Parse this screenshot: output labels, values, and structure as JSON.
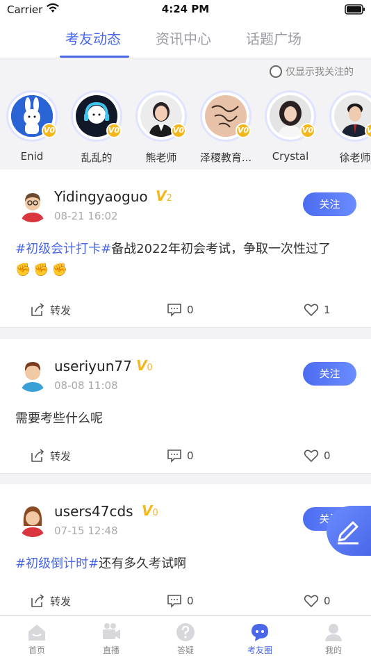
{
  "status_bar": {
    "carrier": "Carrier",
    "time": "4:24 PM"
  },
  "tabs": [
    {
      "label": "考友动态",
      "active": true
    },
    {
      "label": "资讯中心",
      "active": false
    },
    {
      "label": "话题广场",
      "active": false
    }
  ],
  "filter": {
    "label": "仅显示我关注的",
    "checked": false
  },
  "celebrities": [
    {
      "name": "Enid",
      "badge": "V0"
    },
    {
      "name": "乱乱的",
      "badge": "V0"
    },
    {
      "name": "熊老师",
      "badge": "V0"
    },
    {
      "name": "泽稷教育...",
      "badge": "V0"
    },
    {
      "name": "Crystal",
      "badge": "V0"
    },
    {
      "name": "徐老师",
      "badge": "V0"
    }
  ],
  "posts": [
    {
      "user": "Yidingyaoguo",
      "level": "2",
      "time": "08-21 16:02",
      "follow_label": "关注",
      "hashtag": "#初级会计打卡#",
      "text": "备战2022年初会考试，争取一次性过了",
      "emoji": "✊✊✊",
      "forward_label": "转发",
      "comments": "0",
      "likes": "1"
    },
    {
      "user": "useriyun77",
      "level": "0",
      "time": "08-08 11:08",
      "follow_label": "关注",
      "hashtag": "",
      "text": "需要考些什么呢",
      "forward_label": "转发",
      "comments": "0",
      "likes": "0"
    },
    {
      "user": "users47cds",
      "level": "0",
      "time": "07-15 12:48",
      "follow_label": "关注",
      "hashtag": "#初级倒计时#",
      "text": "还有多久考试啊",
      "forward_label": "转发",
      "comments": "0",
      "likes": "0"
    }
  ],
  "bottom_nav": [
    {
      "label": "首页",
      "icon": "home-icon",
      "active": false
    },
    {
      "label": "直播",
      "icon": "video-icon",
      "active": false
    },
    {
      "label": "答疑",
      "icon": "question-icon",
      "active": false
    },
    {
      "label": "考友圈",
      "icon": "chat-icon",
      "active": true
    },
    {
      "label": "我的",
      "icon": "profile-icon",
      "active": false
    }
  ],
  "colors": {
    "accent": "#4a67e8",
    "badge": "#f4b81f"
  }
}
